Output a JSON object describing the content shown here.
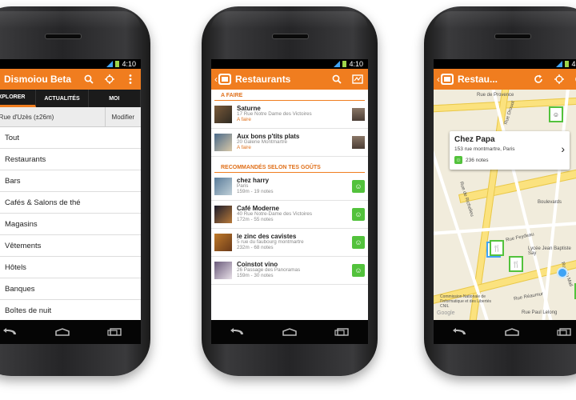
{
  "status_time": "4:10",
  "colors": {
    "accent": "#f07d1f",
    "smiley_green": "#53c23c",
    "location_blue": "#3fa3f5"
  },
  "phone1": {
    "title": "Dismoiou Beta",
    "tabs": [
      "EXPLORER",
      "ACTUALITÉS",
      "MOI"
    ],
    "location": "3 Rue d'Uzès (±26m)",
    "modify_label": "Modifier",
    "categories": [
      {
        "label": "Tout",
        "icon": "globe-icon"
      },
      {
        "label": "Restaurants",
        "icon": "fork-knife-icon"
      },
      {
        "label": "Bars",
        "icon": "beer-icon"
      },
      {
        "label": "Cafés & Salons de thé",
        "icon": "coffee-cup-icon"
      },
      {
        "label": "Magasins",
        "icon": "shopping-bag-icon"
      },
      {
        "label": "Vêtements",
        "icon": "tshirt-icon"
      },
      {
        "label": "Hôtels",
        "icon": "bed-icon"
      },
      {
        "label": "Banques",
        "icon": "dollar-icon"
      },
      {
        "label": "Boîtes de nuit",
        "icon": "nightclub-icon"
      }
    ]
  },
  "phone2": {
    "title": "Restaurants",
    "section_todo": "A FAIRE",
    "todo_items": [
      {
        "name": "Saturne",
        "address": "17 Rue Notre Dame des Victoires",
        "tag": "A faire"
      },
      {
        "name": "Aux bons p'tits plats",
        "address": "20 Galerie Montmartre",
        "tag": "A faire"
      }
    ],
    "section_recommended": "RECOMMANDÉS SELON TES GOÛTS",
    "recommended_items": [
      {
        "name": "chez harry",
        "address": "Paris",
        "meta": "159m - 19 notes"
      },
      {
        "name": "Café Moderne",
        "address": "40 Rue Notre-Dame des Victoires",
        "meta": "172m - 55 notes"
      },
      {
        "name": "le zinc des cavistes",
        "address": "5 rue du faubourg montmartre",
        "meta": "232m - 68 notes"
      },
      {
        "name": "Coinstot vino",
        "address": "26 Passage des Panoramas",
        "meta": "159m - 30 notes"
      }
    ]
  },
  "phone3": {
    "title": "Restau...",
    "popup": {
      "name": "Chez Papa",
      "address": "153 rue montmartre, Paris",
      "notes": "236 notes"
    },
    "map_labels": {
      "rue_de_provence": "Rue de Provence",
      "rue_drouot": "Rue Drouot",
      "rue_de_richelieu": "Rue de Richelieu",
      "boulevards": "Boulevards",
      "rue_feydeau": "Rue Feydeau",
      "lycee": "Lycée Jean Baptiste Say",
      "rue_reaumur": "Rue Réaumur",
      "rue_du_mail": "Rue du Mail",
      "rue_paul_lelong": "Rue Paul Lelong",
      "cnil": "Commission Nationale de l'Informatique et des Libertés CNIL",
      "google": "Google"
    }
  }
}
